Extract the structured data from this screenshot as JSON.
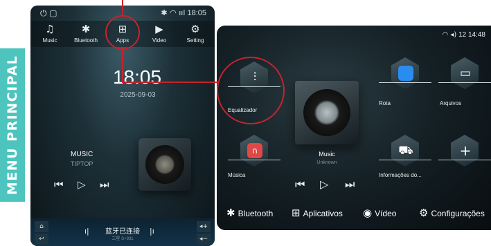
{
  "side_label": "MENU PRINCIPAL",
  "colors": {
    "accent": "#4dc4bd",
    "callout": "#c8232c",
    "icon_music_app": "#e04848",
    "icon_map_app": "#2a8cf0"
  },
  "phone": {
    "status_time": "18:05",
    "nav": [
      {
        "label": "Music",
        "icon": "music-note-icon"
      },
      {
        "label": "Bluetooth",
        "icon": "bluetooth-icon"
      },
      {
        "label": "Apps",
        "icon": "apps-grid-icon"
      },
      {
        "label": "Video",
        "icon": "play-circle-icon"
      },
      {
        "label": "Setting",
        "icon": "gear-icon"
      }
    ],
    "clock": "18:05",
    "date": "2025-09-03",
    "music_title": "MUSIC",
    "music_artist": "TIPTOP",
    "bt_status": "蓝牙已连接",
    "bt_sub": "三星 S+931"
  },
  "landscape": {
    "status": "12  14:48",
    "apps_top": [
      {
        "label": "Equalizador",
        "icon": "equalizer-icon"
      },
      {
        "label": "Rota",
        "icon": "map-route-icon"
      },
      {
        "label": "Arquivos",
        "icon": "folder-icon"
      }
    ],
    "apps_bottom": [
      {
        "label": "Música",
        "icon": "headphones-icon"
      },
      {
        "label": "Informações do...",
        "icon": "car-icon"
      },
      {
        "label": "",
        "icon": "add-icon"
      }
    ],
    "music_title": "Music",
    "music_sub": "Unknown",
    "dock": [
      {
        "label": "Bluetooth",
        "icon": "bluetooth-icon"
      },
      {
        "label": "Aplicativos",
        "icon": "apps-grid-icon"
      },
      {
        "label": "Vídeo",
        "icon": "play-circle-icon"
      },
      {
        "label": "Configurações",
        "icon": "gear-icon"
      }
    ]
  }
}
